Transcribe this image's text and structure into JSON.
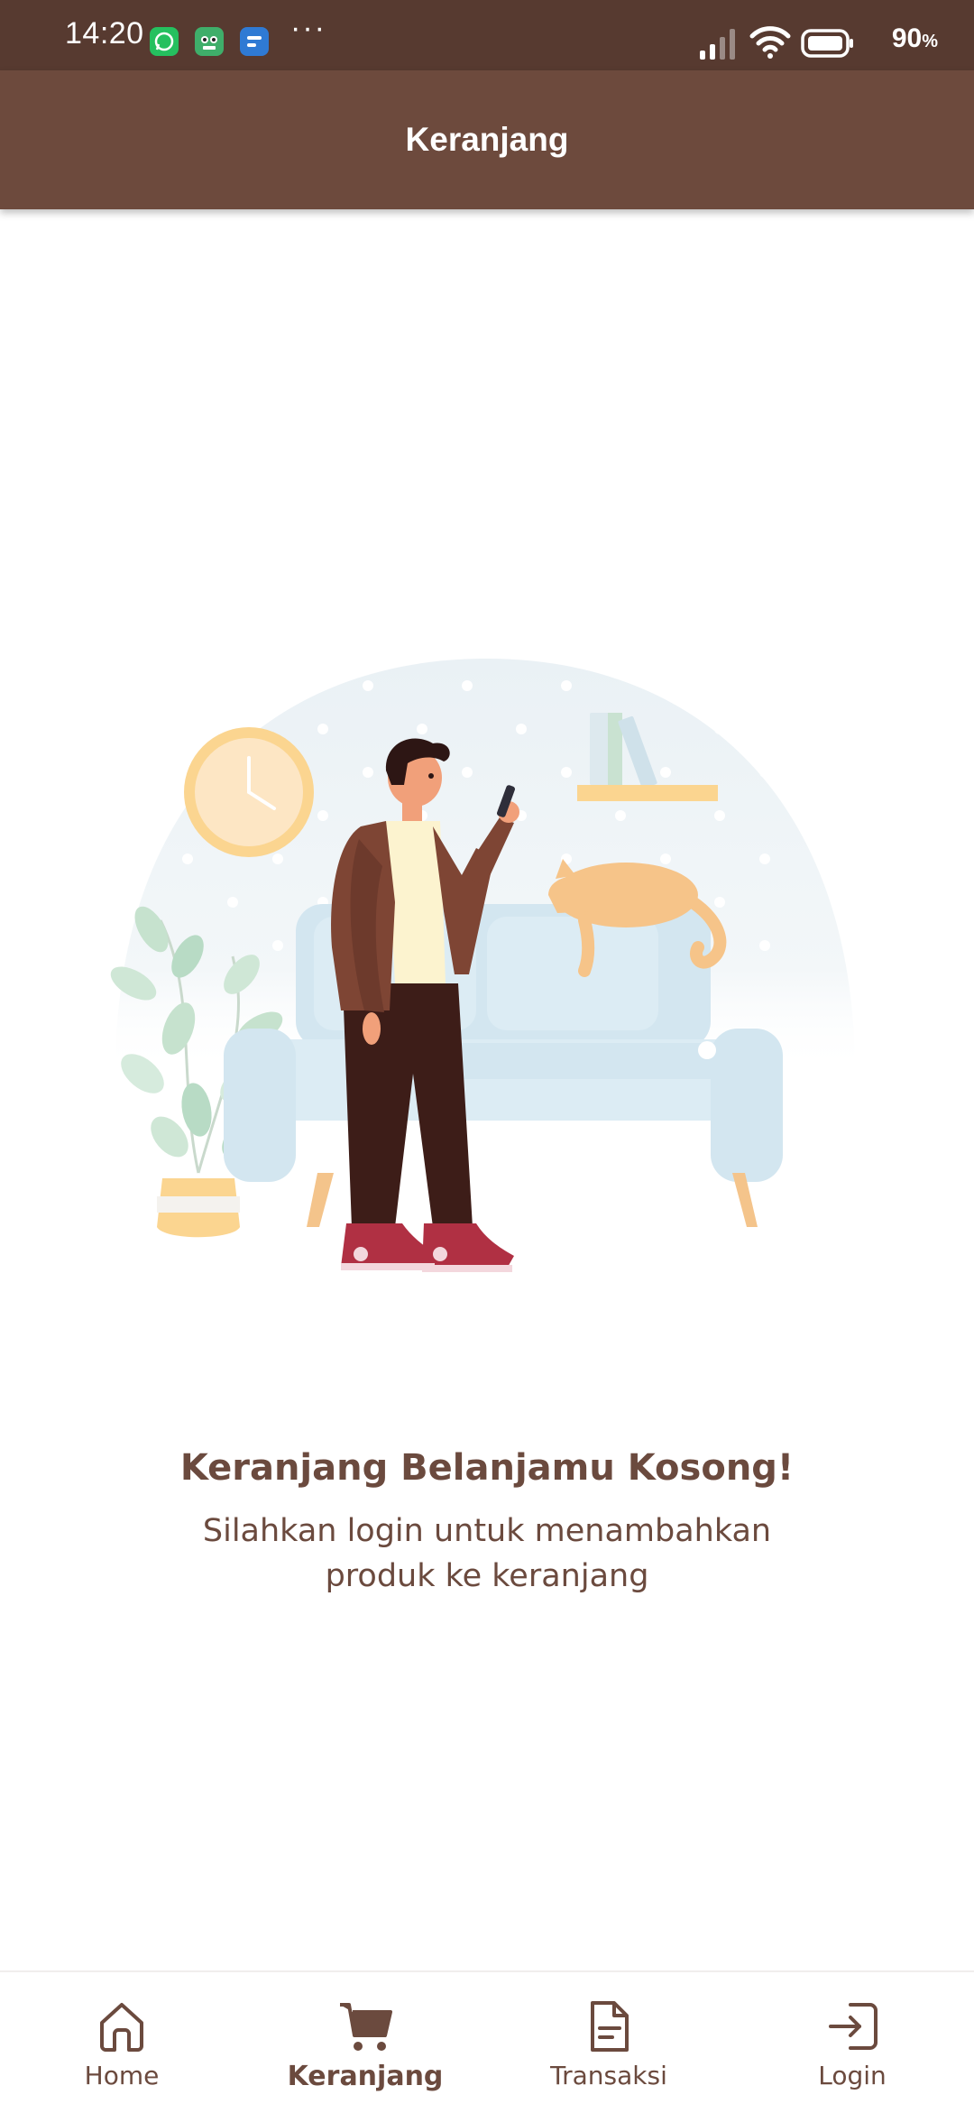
{
  "status_bar": {
    "time": "14:20",
    "dots": "···",
    "battery_percent": "90",
    "battery_unit": "%",
    "icons": [
      "whatsapp-icon",
      "app-notification-icon",
      "message-app-icon",
      "signal-icon",
      "wifi-icon",
      "battery-icon"
    ]
  },
  "app_bar": {
    "title": "Keranjang"
  },
  "empty_state": {
    "title": "Keranjang Belanjamu Kosong!",
    "subtitle": "Silahkan login untuk menambahkan produk ke keranjang"
  },
  "bottom_nav": {
    "items": [
      {
        "label": "Home",
        "icon": "home-icon",
        "active": false
      },
      {
        "label": "Keranjang",
        "icon": "cart-icon",
        "active": true
      },
      {
        "label": "Transaksi",
        "icon": "document-icon",
        "active": false
      },
      {
        "label": "Login",
        "icon": "login-icon",
        "active": false
      }
    ]
  },
  "colors": {
    "status_bar": "#573a30",
    "app_bar": "#6d4a3d",
    "text_brown": "#6b4a3e",
    "background": "#ffffff"
  }
}
